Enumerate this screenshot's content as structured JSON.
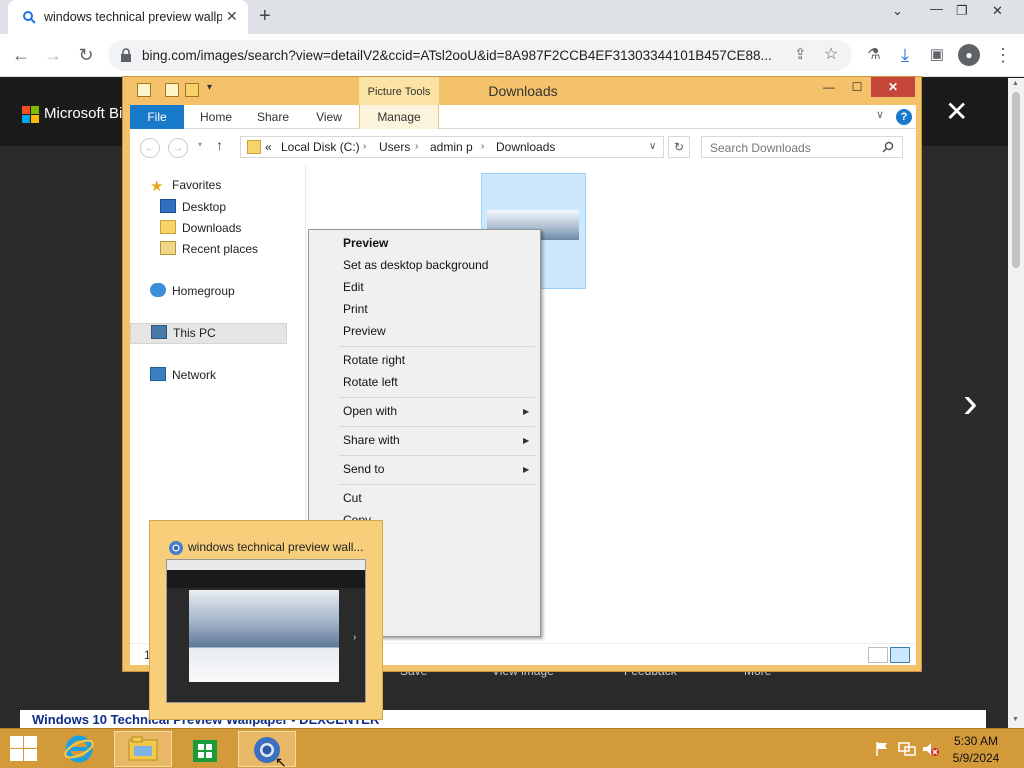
{
  "browser": {
    "tab_title": "windows technical preview wallp",
    "url": "bing.com/images/search?view=detailV2&ccid=ATsl2ooU&id=8A987F2CCB4EF31303344101B457CE88..."
  },
  "bing": {
    "brand": "Microsoft Bi",
    "actions": [
      "Save",
      "View image",
      "Feedback",
      "More"
    ],
    "bottom_title": "Windows 10 Technical Preview Wallpaper - DEXCENTER"
  },
  "explorer": {
    "title": "Downloads",
    "contextual_tab": "Picture Tools",
    "tabs": [
      "File",
      "Home",
      "Share",
      "View",
      "Manage"
    ],
    "breadcrumb": [
      "«",
      "Local Disk (C:)",
      "Users",
      "admin p",
      "Downloads"
    ],
    "search_placeholder": "Search Downloads",
    "nav": {
      "favorites": "Favorites",
      "desktop": "Desktop",
      "downloads": "Downloads",
      "recent": "Recent places",
      "homegroup": "Homegroup",
      "this_pc": "This PC",
      "network": "Network"
    },
    "status": "1"
  },
  "context_menu": {
    "items": [
      {
        "label": "Preview",
        "bold": true
      },
      {
        "label": "Set as desktop background"
      },
      {
        "label": "Edit"
      },
      {
        "label": "Print"
      },
      {
        "label": "Preview"
      },
      {
        "label": "Rotate right"
      },
      {
        "label": "Rotate left"
      },
      {
        "label": "Open with",
        "submenu": true
      },
      {
        "label": "Share with",
        "submenu": true
      },
      {
        "label": "Send to",
        "submenu": true
      },
      {
        "label": "Cut"
      },
      {
        "label": "Copy"
      },
      {
        "label": "hortcut"
      },
      {
        "label": "e"
      },
      {
        "label": "es"
      }
    ]
  },
  "taskbar_preview": {
    "title": "windows technical preview wall..."
  },
  "taskbar": {
    "time": "5:30 AM",
    "date": "5/9/2024"
  },
  "colors": {
    "explorer_frame": "#f4c26b",
    "taskbar": "#d39a3a",
    "file_tab": "#1979ca",
    "close_button": "#c7463a",
    "selection": "#cce8ff"
  }
}
